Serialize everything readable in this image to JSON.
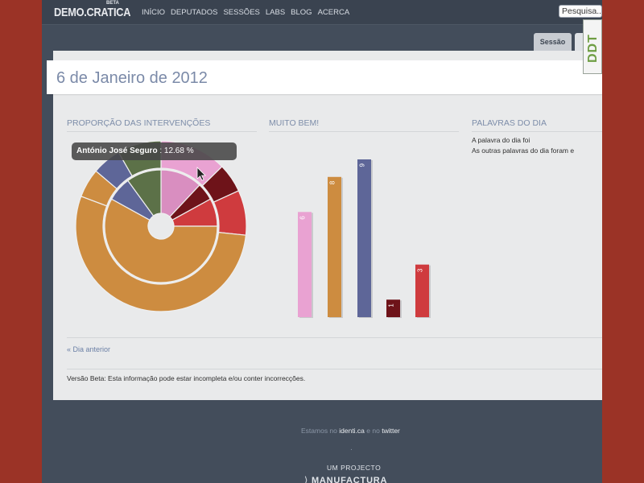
{
  "nav": {
    "logo": "DEMO.CRATICA",
    "beta": "BETA",
    "items": [
      "INÍCIO",
      "DEPUTADOS",
      "SESSÕES",
      "LABS",
      "BLOG",
      "ACERCA"
    ],
    "search_placeholder": "Pesquisa..."
  },
  "tabs": {
    "sessao": "Sessão",
    "next": ""
  },
  "ddt_logo": "DDT",
  "page": {
    "title": "6 de Janeiro de 2012",
    "prop_heading": "PROPORÇÃO DAS INTERVENÇÕES",
    "muito_heading": "MUITO BEM!",
    "palavras_heading": "PALAVRAS DO DIA",
    "palavras_line1": "A palavra do dia foi",
    "palavras_line2": "As outras palavras do dia foram e",
    "prev_link": "« Dia anterior",
    "beta_note": "Versão Beta: Esta informação pode estar incompleta e/ou conter incorrecções."
  },
  "tooltip": {
    "name": "António José Seguro",
    "value": ": 12.68 %"
  },
  "colors": {
    "pink": "#e9a2d2",
    "pink_inner": "#d98ec0",
    "darkred": "#6e1319",
    "red": "#cf3b3e",
    "orange": "#cd8c40",
    "blue": "#5e6698",
    "green": "#5c7148",
    "background": "#9b3326",
    "viewport": "#434d5b"
  },
  "chart_data": [
    {
      "type": "pie",
      "title": "PROPORÇÃO DAS INTERVENÇÕES",
      "description_outer_ring": "outer ring",
      "outer_labels": [],
      "outer": [
        {
          "color": "#e9a2d2",
          "value": 12.68
        },
        {
          "color": "#6e1319",
          "value": 5.5
        },
        {
          "color": "#cf3b3e",
          "value": 8.5
        },
        {
          "color": "#cd8c40",
          "value": 54
        },
        {
          "color": "#cd8c40",
          "value": 5.5
        },
        {
          "color": "#5e6698",
          "value": 5.5
        },
        {
          "color": "#5c7148",
          "value": 8.3
        }
      ],
      "inner": [
        {
          "color": "#d98ec0",
          "value": 12
        },
        {
          "color": "#6e1319",
          "value": 5
        },
        {
          "color": "#cf3b3e",
          "value": 8
        },
        {
          "color": "#cd8c40",
          "value": 58
        },
        {
          "color": "#5e6698",
          "value": 7
        },
        {
          "color": "#5c7148",
          "value": 10
        }
      ]
    },
    {
      "type": "bar",
      "title": "MUITO BEM!",
      "categories": [
        "",
        "",
        "",
        "",
        ""
      ],
      "values": [
        6,
        8,
        9,
        1,
        3
      ],
      "labels": [
        "6",
        "8",
        "9",
        "1",
        "3"
      ],
      "colors": [
        "#e9a2d2",
        "#cd8c40",
        "#5e6698",
        "#6e1319",
        "#cf3b3e"
      ],
      "ylim": [
        0,
        9
      ]
    }
  ],
  "footer": {
    "text_prefix": "Estamos no ",
    "identica": "identi.ca",
    "text_mid": " e no ",
    "twitter": "twitter",
    "dot": ".",
    "project": "UM PROJECTO",
    "manufactura": "MANUFACTURA"
  }
}
